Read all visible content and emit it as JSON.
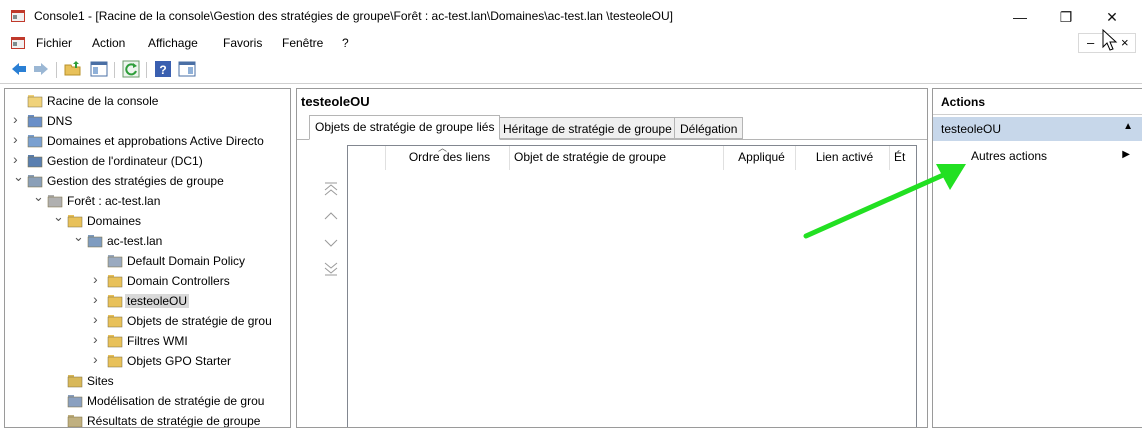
{
  "window": {
    "title": "Console1 - [Racine de la console\\Gestion des stratégies de groupe\\Forêt : ac-test.lan\\Domaines\\ac-test.lan \\testeoleOU]",
    "minimize": "—",
    "restore": "❐",
    "close": "✕"
  },
  "menu": {
    "items": [
      "Fichier",
      "Action",
      "Affichage",
      "Favoris",
      "Fenêtre",
      "?"
    ],
    "mdi_minimize": "–",
    "mdi_close": "×"
  },
  "tree": {
    "items": [
      {
        "label": "Racine de la console",
        "icon": "folder-icon"
      },
      {
        "label": "DNS",
        "icon": "dns-icon"
      },
      {
        "label": "Domaines et approbations Active Directo",
        "icon": "domains-trusts-icon"
      },
      {
        "label": "Gestion de l'ordinateur (DC1)",
        "icon": "computer-management-icon"
      },
      {
        "label": "Gestion des stratégies de groupe",
        "icon": "gpmc-icon"
      },
      {
        "label": "Forêt : ac-test.lan",
        "icon": "forest-icon"
      },
      {
        "label": "Domaines",
        "icon": "domains-folder-icon"
      },
      {
        "label": "ac-test.lan",
        "icon": "domain-icon"
      },
      {
        "label": "Default Domain Policy",
        "icon": "gpo-link-icon"
      },
      {
        "label": "Domain Controllers",
        "icon": "ou-icon"
      },
      {
        "label": "testeoleOU",
        "icon": "ou-icon"
      },
      {
        "label": "Objets de stratégie de grou",
        "icon": "gpo-folder-icon"
      },
      {
        "label": "Filtres WMI",
        "icon": "wmi-folder-icon"
      },
      {
        "label": "Objets GPO Starter",
        "icon": "starter-gpo-folder-icon"
      },
      {
        "label": "Sites",
        "icon": "sites-icon"
      },
      {
        "label": "Modélisation de stratégie de grou",
        "icon": "modeling-icon"
      },
      {
        "label": "Résultats de stratégie de groupe",
        "icon": "results-icon"
      }
    ]
  },
  "center": {
    "title": "testeoleOU",
    "tabs": [
      "Objets de stratégie de groupe liés",
      "Héritage de stratégie de groupe",
      "Délégation"
    ],
    "columns": [
      "Ordre des liens",
      "Objet de stratégie de groupe",
      "Appliqué",
      "Lien activé",
      "Ét"
    ]
  },
  "actions": {
    "header": "Actions",
    "group": "testeoleOU",
    "item": "Autres actions"
  },
  "colors": {
    "annotation_arrow": "#22e022",
    "selection": "#d9d9d9",
    "action_group_bg": "#c7d7ea"
  }
}
